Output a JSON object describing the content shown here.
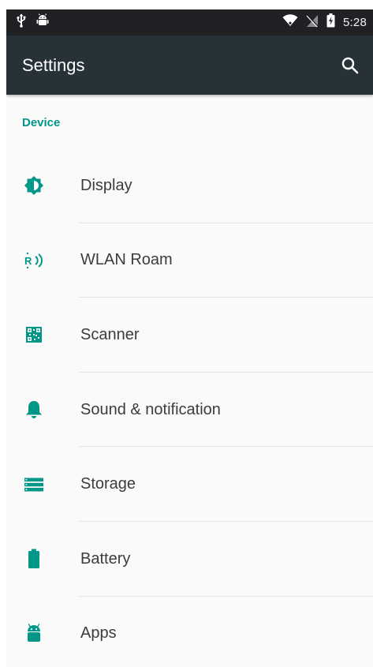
{
  "status_bar": {
    "time": "5:28",
    "left_icons": [
      "usb-icon",
      "android-debug-icon"
    ],
    "right_icons": [
      "wifi-icon",
      "no-sim-icon",
      "battery-charging-icon"
    ]
  },
  "toolbar": {
    "title": "Settings",
    "search_icon": "search-icon"
  },
  "section": {
    "header": "Device",
    "accent_color": "#009688"
  },
  "colors": {
    "toolbar": "#263238",
    "statusbar": "#202125",
    "accent": "#009688",
    "background": "#fafafa"
  },
  "items": [
    {
      "label": "Display",
      "icon": "brightness-icon"
    },
    {
      "label": "WLAN Roam",
      "icon": "wlan-roam-icon"
    },
    {
      "label": "Scanner",
      "icon": "qr-scanner-icon"
    },
    {
      "label": "Sound & notification",
      "icon": "bell-icon"
    },
    {
      "label": "Storage",
      "icon": "storage-icon"
    },
    {
      "label": "Battery",
      "icon": "battery-icon"
    },
    {
      "label": "Apps",
      "icon": "android-icon"
    }
  ]
}
